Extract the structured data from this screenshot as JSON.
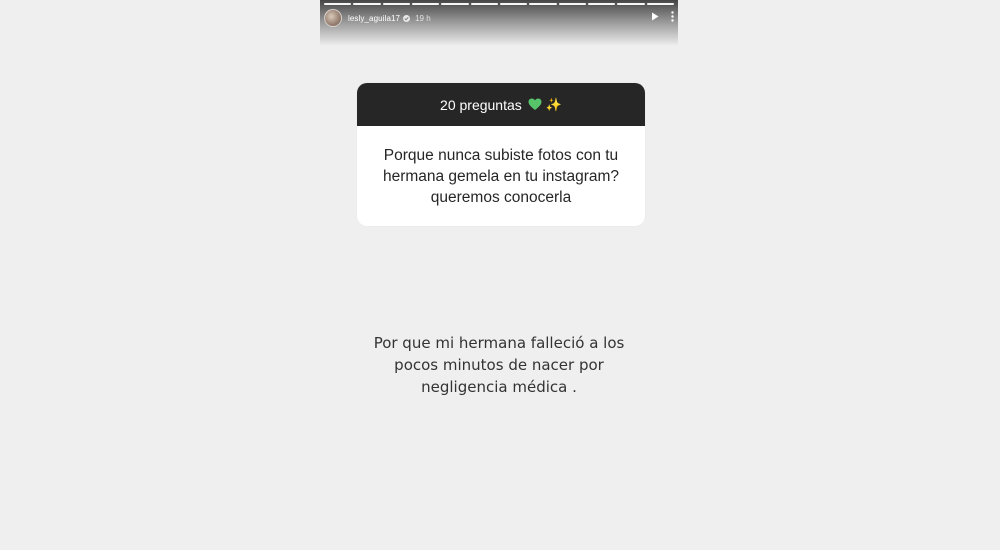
{
  "story": {
    "username": "lesly_aguila17",
    "time": "19 h",
    "progress": {
      "segments": 12,
      "completed": 12
    },
    "icons": {
      "avatar": "profile-photo",
      "verified": "verified-badge-icon",
      "play": "play-icon",
      "more": "more-options-icon"
    }
  },
  "question_sticker": {
    "title": "20 preguntas",
    "emojis": [
      "green-heart",
      "sparkles"
    ],
    "question_lines": [
      "Porque nunca subiste fotos con tu",
      "hermana gemela en tu instagram?",
      "queremos conocerla"
    ]
  },
  "answer_lines": [
    "Por que mi hermana falleció a los",
    "pocos minutos de nacer por",
    "negligencia médica ."
  ],
  "colors": {
    "background": "#efefef",
    "card_header": "#262626",
    "card_body": "#ffffff",
    "heart": "#58c46a",
    "sparkle": "#f6c84a"
  }
}
